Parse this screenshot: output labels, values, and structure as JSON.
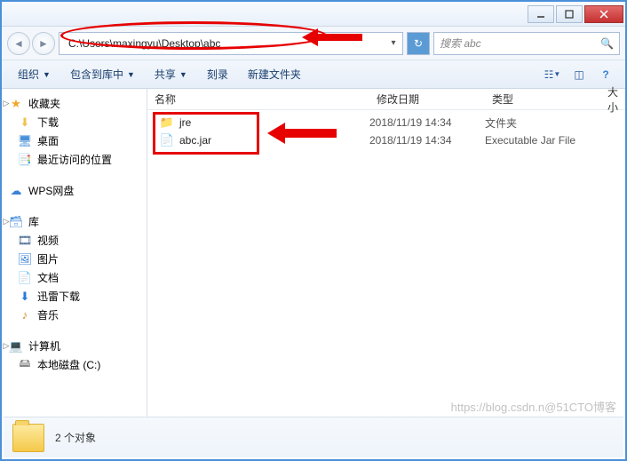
{
  "window": {
    "path": "C:\\Users\\maxingyu\\Desktop\\abc",
    "search_placeholder": "搜索 abc"
  },
  "toolbar": {
    "organize": "组织",
    "include": "包含到库中",
    "share": "共享",
    "burn": "刻录",
    "newfolder": "新建文件夹"
  },
  "sidebar": {
    "favorites": "收藏夹",
    "downloads": "下载",
    "desktop": "桌面",
    "recent": "最近访问的位置",
    "wps": "WPS网盘",
    "libraries": "库",
    "videos": "视频",
    "pictures": "图片",
    "documents": "文档",
    "xunlei": "迅雷下载",
    "music": "音乐",
    "computer": "计算机",
    "localdisk": "本地磁盘 (C:)"
  },
  "columns": {
    "name": "名称",
    "date": "修改日期",
    "type": "类型",
    "size": "大小"
  },
  "files": [
    {
      "name": "jre",
      "date": "2018/11/19 14:34",
      "type": "文件夹",
      "icon": "folder"
    },
    {
      "name": "abc.jar",
      "date": "2018/11/19 14:34",
      "type": "Executable Jar File",
      "icon": "jar"
    }
  ],
  "status": {
    "count_label": "2 个对象"
  },
  "watermark": "https://blog.csdn.n@51CTO博客"
}
